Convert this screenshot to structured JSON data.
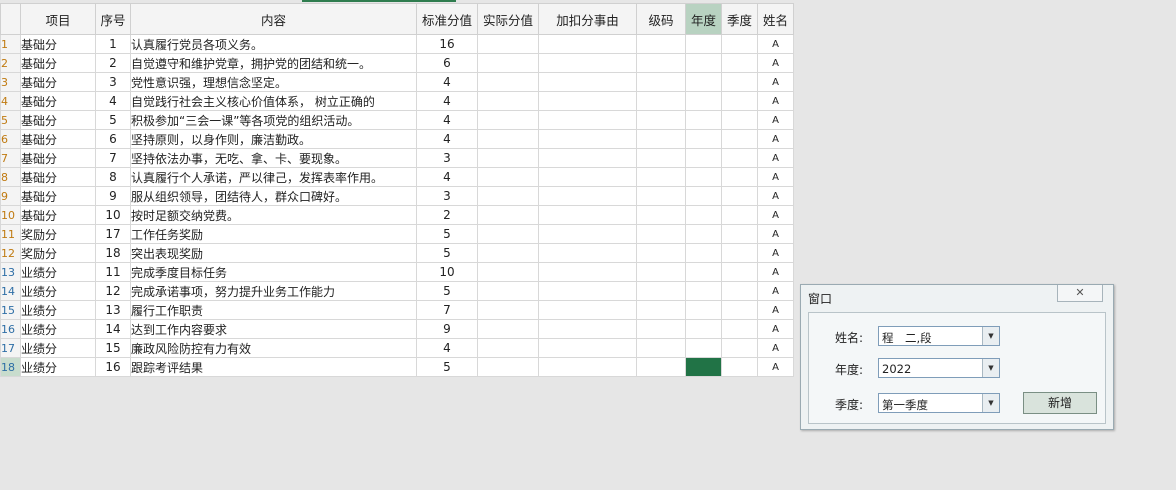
{
  "sheet": {
    "headers": [
      "项目",
      "序号",
      "内容",
      "标准分值",
      "实际分值",
      "加扣分事由",
      "级码",
      "年度",
      "季度",
      "姓名"
    ],
    "rows": [
      {
        "rn": "1",
        "cat": "基础分",
        "no": "1",
        "content": "认真履行党员各项义务。",
        "score": "16",
        "name": "A"
      },
      {
        "rn": "2",
        "cat": "基础分",
        "no": "2",
        "content": "自觉遵守和维护党章，拥护党的团结和统一。",
        "score": "6",
        "name": "A"
      },
      {
        "rn": "3",
        "cat": "基础分",
        "no": "3",
        "content": "党性意识强，理想信念坚定。",
        "score": "4",
        "name": "A"
      },
      {
        "rn": "4",
        "cat": "基础分",
        "no": "4",
        "content": "自觉践行社会主义核心价值体系， 树立正确的",
        "score": "4",
        "name": "A"
      },
      {
        "rn": "5",
        "cat": "基础分",
        "no": "5",
        "content": "积极参加“三会一课”等各项党的组织活动。",
        "score": "4",
        "name": "A"
      },
      {
        "rn": "6",
        "cat": "基础分",
        "no": "6",
        "content": "坚持原则，以身作则，廉洁勤政。",
        "score": "4",
        "name": "A"
      },
      {
        "rn": "7",
        "cat": "基础分",
        "no": "7",
        "content": "坚持依法办事，无吃、拿、卡、要现象。",
        "score": "3",
        "name": "A"
      },
      {
        "rn": "8",
        "cat": "基础分",
        "no": "8",
        "content": "认真履行个人承诺，严以律己，发挥表率作用。",
        "score": "4",
        "name": "A"
      },
      {
        "rn": "9",
        "cat": "基础分",
        "no": "9",
        "content": "服从组织领导，团结待人，群众口碑好。",
        "score": "3",
        "name": "A"
      },
      {
        "rn": "10",
        "cat": "基础分",
        "no": "10",
        "content": "按时足额交纳党费。",
        "score": "2",
        "name": "A"
      },
      {
        "rn": "11",
        "cat": "奖励分",
        "no": "17",
        "content": "工作任务奖励",
        "score": "5",
        "name": "A"
      },
      {
        "rn": "12",
        "cat": "奖励分",
        "no": "18",
        "content": "突出表现奖励",
        "score": "5",
        "name": "A"
      },
      {
        "rn": "13",
        "cat": "业绩分",
        "no": "11",
        "content": "完成季度目标任务",
        "score": "10",
        "name": "A"
      },
      {
        "rn": "14",
        "cat": "业绩分",
        "no": "12",
        "content": "完成承诺事项，努力提升业务工作能力",
        "score": "5",
        "name": "A"
      },
      {
        "rn": "15",
        "cat": "业绩分",
        "no": "13",
        "content": "履行工作职责",
        "score": "7",
        "name": "A"
      },
      {
        "rn": "16",
        "cat": "业绩分",
        "no": "14",
        "content": "达到工作内容要求",
        "score": "9",
        "name": "A"
      },
      {
        "rn": "17",
        "cat": "业绩分",
        "no": "15",
        "content": "廉政风险防控有力有效",
        "score": "4",
        "name": "A"
      },
      {
        "rn": "18",
        "cat": "业绩分",
        "no": "16",
        "content": "跟踪考评结果",
        "score": "5",
        "name": "A"
      }
    ]
  },
  "dialog": {
    "title": "窗口",
    "close_glyph": "✕",
    "name_label": "姓名:",
    "name_value": "程　二,段　",
    "year_label": "年度:",
    "year_value": "2022",
    "season_label": "季度:",
    "season_value": "第一季度",
    "add_button": "新增",
    "dropdown_glyph": "▼"
  },
  "colors": {
    "accent": "#217346",
    "row_number": "#c07a10",
    "row_number_blue": "#2e6ea6"
  }
}
